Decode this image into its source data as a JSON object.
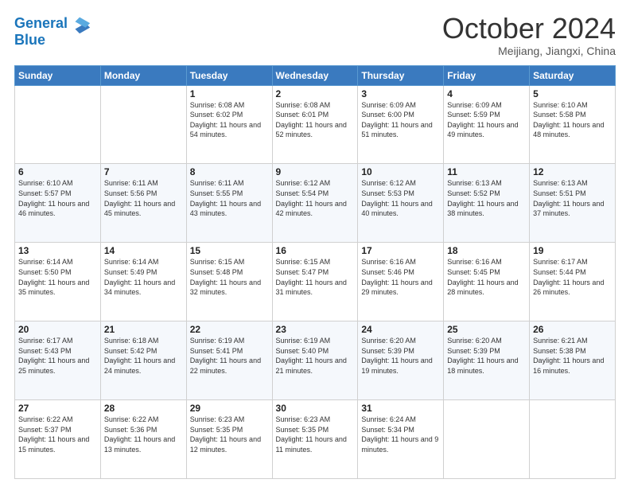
{
  "header": {
    "logo_line1": "General",
    "logo_line2": "Blue",
    "title": "October 2024",
    "subtitle": "Meijiang, Jiangxi, China"
  },
  "days_of_week": [
    "Sunday",
    "Monday",
    "Tuesday",
    "Wednesday",
    "Thursday",
    "Friday",
    "Saturday"
  ],
  "weeks": [
    [
      {
        "day": "",
        "sunrise": "",
        "sunset": "",
        "daylight": ""
      },
      {
        "day": "",
        "sunrise": "",
        "sunset": "",
        "daylight": ""
      },
      {
        "day": "1",
        "sunrise": "Sunrise: 6:08 AM",
        "sunset": "Sunset: 6:02 PM",
        "daylight": "Daylight: 11 hours and 54 minutes."
      },
      {
        "day": "2",
        "sunrise": "Sunrise: 6:08 AM",
        "sunset": "Sunset: 6:01 PM",
        "daylight": "Daylight: 11 hours and 52 minutes."
      },
      {
        "day": "3",
        "sunrise": "Sunrise: 6:09 AM",
        "sunset": "Sunset: 6:00 PM",
        "daylight": "Daylight: 11 hours and 51 minutes."
      },
      {
        "day": "4",
        "sunrise": "Sunrise: 6:09 AM",
        "sunset": "Sunset: 5:59 PM",
        "daylight": "Daylight: 11 hours and 49 minutes."
      },
      {
        "day": "5",
        "sunrise": "Sunrise: 6:10 AM",
        "sunset": "Sunset: 5:58 PM",
        "daylight": "Daylight: 11 hours and 48 minutes."
      }
    ],
    [
      {
        "day": "6",
        "sunrise": "Sunrise: 6:10 AM",
        "sunset": "Sunset: 5:57 PM",
        "daylight": "Daylight: 11 hours and 46 minutes."
      },
      {
        "day": "7",
        "sunrise": "Sunrise: 6:11 AM",
        "sunset": "Sunset: 5:56 PM",
        "daylight": "Daylight: 11 hours and 45 minutes."
      },
      {
        "day": "8",
        "sunrise": "Sunrise: 6:11 AM",
        "sunset": "Sunset: 5:55 PM",
        "daylight": "Daylight: 11 hours and 43 minutes."
      },
      {
        "day": "9",
        "sunrise": "Sunrise: 6:12 AM",
        "sunset": "Sunset: 5:54 PM",
        "daylight": "Daylight: 11 hours and 42 minutes."
      },
      {
        "day": "10",
        "sunrise": "Sunrise: 6:12 AM",
        "sunset": "Sunset: 5:53 PM",
        "daylight": "Daylight: 11 hours and 40 minutes."
      },
      {
        "day": "11",
        "sunrise": "Sunrise: 6:13 AM",
        "sunset": "Sunset: 5:52 PM",
        "daylight": "Daylight: 11 hours and 38 minutes."
      },
      {
        "day": "12",
        "sunrise": "Sunrise: 6:13 AM",
        "sunset": "Sunset: 5:51 PM",
        "daylight": "Daylight: 11 hours and 37 minutes."
      }
    ],
    [
      {
        "day": "13",
        "sunrise": "Sunrise: 6:14 AM",
        "sunset": "Sunset: 5:50 PM",
        "daylight": "Daylight: 11 hours and 35 minutes."
      },
      {
        "day": "14",
        "sunrise": "Sunrise: 6:14 AM",
        "sunset": "Sunset: 5:49 PM",
        "daylight": "Daylight: 11 hours and 34 minutes."
      },
      {
        "day": "15",
        "sunrise": "Sunrise: 6:15 AM",
        "sunset": "Sunset: 5:48 PM",
        "daylight": "Daylight: 11 hours and 32 minutes."
      },
      {
        "day": "16",
        "sunrise": "Sunrise: 6:15 AM",
        "sunset": "Sunset: 5:47 PM",
        "daylight": "Daylight: 11 hours and 31 minutes."
      },
      {
        "day": "17",
        "sunrise": "Sunrise: 6:16 AM",
        "sunset": "Sunset: 5:46 PM",
        "daylight": "Daylight: 11 hours and 29 minutes."
      },
      {
        "day": "18",
        "sunrise": "Sunrise: 6:16 AM",
        "sunset": "Sunset: 5:45 PM",
        "daylight": "Daylight: 11 hours and 28 minutes."
      },
      {
        "day": "19",
        "sunrise": "Sunrise: 6:17 AM",
        "sunset": "Sunset: 5:44 PM",
        "daylight": "Daylight: 11 hours and 26 minutes."
      }
    ],
    [
      {
        "day": "20",
        "sunrise": "Sunrise: 6:17 AM",
        "sunset": "Sunset: 5:43 PM",
        "daylight": "Daylight: 11 hours and 25 minutes."
      },
      {
        "day": "21",
        "sunrise": "Sunrise: 6:18 AM",
        "sunset": "Sunset: 5:42 PM",
        "daylight": "Daylight: 11 hours and 24 minutes."
      },
      {
        "day": "22",
        "sunrise": "Sunrise: 6:19 AM",
        "sunset": "Sunset: 5:41 PM",
        "daylight": "Daylight: 11 hours and 22 minutes."
      },
      {
        "day": "23",
        "sunrise": "Sunrise: 6:19 AM",
        "sunset": "Sunset: 5:40 PM",
        "daylight": "Daylight: 11 hours and 21 minutes."
      },
      {
        "day": "24",
        "sunrise": "Sunrise: 6:20 AM",
        "sunset": "Sunset: 5:39 PM",
        "daylight": "Daylight: 11 hours and 19 minutes."
      },
      {
        "day": "25",
        "sunrise": "Sunrise: 6:20 AM",
        "sunset": "Sunset: 5:39 PM",
        "daylight": "Daylight: 11 hours and 18 minutes."
      },
      {
        "day": "26",
        "sunrise": "Sunrise: 6:21 AM",
        "sunset": "Sunset: 5:38 PM",
        "daylight": "Daylight: 11 hours and 16 minutes."
      }
    ],
    [
      {
        "day": "27",
        "sunrise": "Sunrise: 6:22 AM",
        "sunset": "Sunset: 5:37 PM",
        "daylight": "Daylight: 11 hours and 15 minutes."
      },
      {
        "day": "28",
        "sunrise": "Sunrise: 6:22 AM",
        "sunset": "Sunset: 5:36 PM",
        "daylight": "Daylight: 11 hours and 13 minutes."
      },
      {
        "day": "29",
        "sunrise": "Sunrise: 6:23 AM",
        "sunset": "Sunset: 5:35 PM",
        "daylight": "Daylight: 11 hours and 12 minutes."
      },
      {
        "day": "30",
        "sunrise": "Sunrise: 6:23 AM",
        "sunset": "Sunset: 5:35 PM",
        "daylight": "Daylight: 11 hours and 11 minutes."
      },
      {
        "day": "31",
        "sunrise": "Sunrise: 6:24 AM",
        "sunset": "Sunset: 5:34 PM",
        "daylight": "Daylight: 11 hours and 9 minutes."
      },
      {
        "day": "",
        "sunrise": "",
        "sunset": "",
        "daylight": ""
      },
      {
        "day": "",
        "sunrise": "",
        "sunset": "",
        "daylight": ""
      }
    ]
  ]
}
